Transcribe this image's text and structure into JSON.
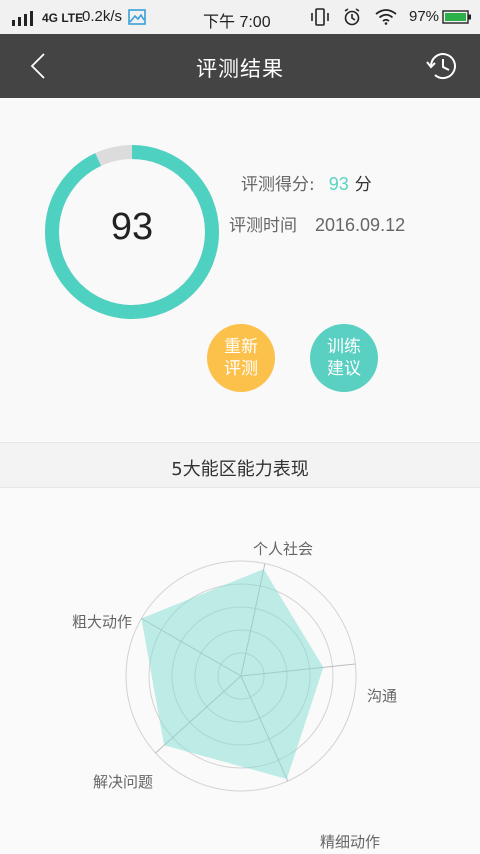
{
  "status_bar": {
    "network": "4G LTE",
    "speed": "0.2k/s",
    "time": "下午 7:00",
    "battery": "97%",
    "battery_color": "#2bb04a"
  },
  "header": {
    "title": "评测结果",
    "back_icon": "chevron-left-icon",
    "history_icon": "history-clock-icon"
  },
  "result": {
    "score_display": "93",
    "score_label": "评测得分:",
    "score_value": "93",
    "score_unit": "分",
    "score_fraction": 0.93,
    "time_label": "评测时间",
    "time_value": "2016.09.12",
    "ring_color": "#4fd1c1",
    "ring_track_color": "#dcdcdc"
  },
  "buttons": {
    "retest_line1": "重新",
    "retest_line2": "评测",
    "advice_line1": "训练",
    "advice_line2": "建议",
    "retest_color": "#fcc14b",
    "advice_color": "#5ad0c3"
  },
  "section": {
    "title": "5大能区能力表现"
  },
  "radar": {
    "axes": [
      "个人社会",
      "沟通",
      "精细动作",
      "解决问题",
      "粗大动作"
    ],
    "values": [
      0.95,
      0.72,
      0.98,
      0.9,
      1.0
    ],
    "fill_color": "#7fdcd0"
  }
}
